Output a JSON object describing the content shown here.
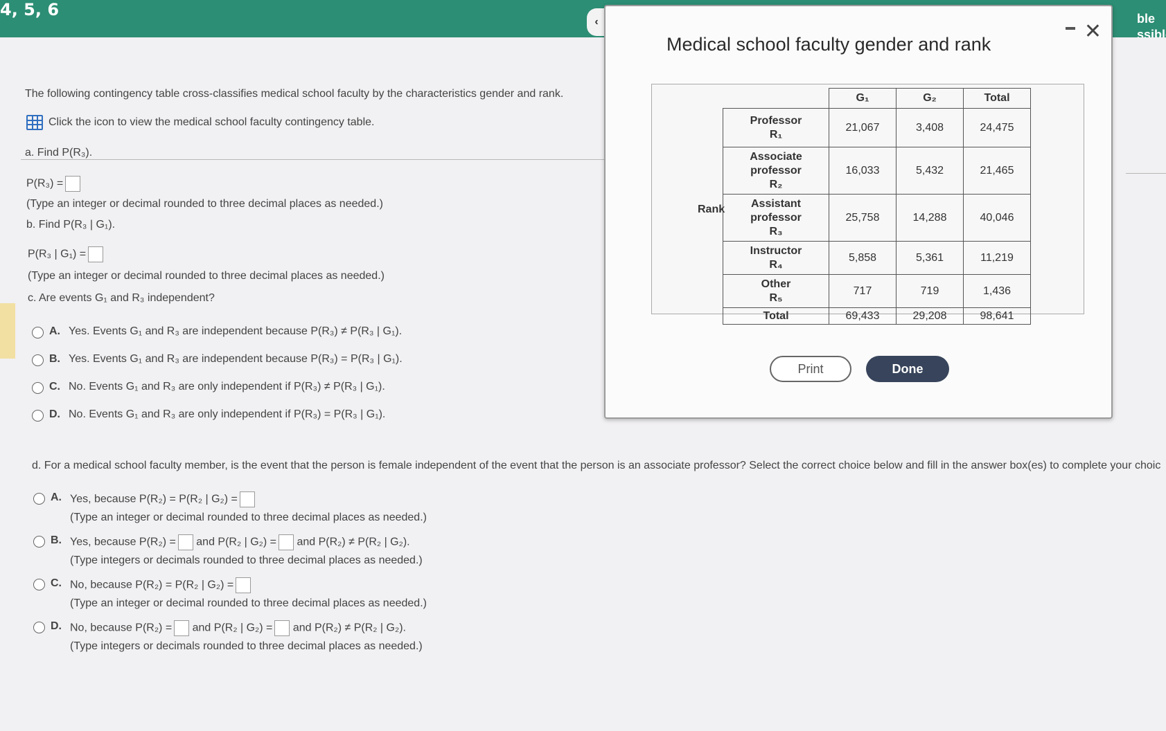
{
  "header": {
    "title": "4, 5, 6",
    "corner_text": "ble ssible"
  },
  "intro": {
    "stem": "The following contingency table cross-classifies medical school faculty by the characteristics gender and rank.",
    "link": "Click the icon to view the medical school faculty contingency table."
  },
  "part_a": {
    "question": "a. Find P(R₃).",
    "answer_label": "P(R₃) =",
    "hint": "(Type an integer or decimal rounded to three decimal places as needed.)"
  },
  "part_b": {
    "question": "b. Find P(R₃ | G₁).",
    "answer_label": "P(R₃ | G₁) =",
    "hint": "(Type an integer or decimal rounded to three decimal places as needed.)"
  },
  "part_c": {
    "question": "c. Are events G₁ and R₃ independent?",
    "options": [
      {
        "letter": "A.",
        "text": "Yes. Events G₁ and R₃ are independent because P(R₃) ≠ P(R₃ | G₁)."
      },
      {
        "letter": "B.",
        "text": "Yes. Events G₁ and R₃ are independent because P(R₃) = P(R₃ | G₁)."
      },
      {
        "letter": "C.",
        "text": "No. Events G₁ and R₃ are only independent if P(R₃) ≠ P(R₃ | G₁)."
      },
      {
        "letter": "D.",
        "text": "No. Events G₁ and R₃ are only independent if P(R₃) = P(R₃ | G₁)."
      }
    ]
  },
  "part_d": {
    "question": "d. For a medical school faculty member, is the event that the person is female independent of the event that the person is an associate professor? Select the correct choice below and fill in the answer box(es) to complete your choic",
    "options": [
      {
        "letter": "A.",
        "text1": "Yes, because P(R₂) = P(R₂ | G₂) =",
        "text2": "",
        "text3": "",
        "hint": "(Type an integer or decimal rounded to three decimal places as needed.)"
      },
      {
        "letter": "B.",
        "text1": "Yes, because P(R₂) =",
        "text2": "and P(R₂ | G₂) =",
        "text3": "and P(R₂) ≠ P(R₂ | G₂).",
        "hint": "(Type integers or decimals rounded to three decimal places as needed.)"
      },
      {
        "letter": "C.",
        "text1": "No, because P(R₂) = P(R₂ | G₂) =",
        "text2": "",
        "text3": "",
        "hint": "(Type an integer or decimal rounded to three decimal places as needed.)"
      },
      {
        "letter": "D.",
        "text1": "No, because P(R₂) =",
        "text2": "and P(R₂ | G₂) =",
        "text3": "and P(R₂) ≠ P(R₂ | G₂).",
        "hint": "(Type integers or decimals rounded to three decimal places as needed.)"
      }
    ]
  },
  "modal": {
    "title": "Medical school faculty gender and rank",
    "rank_label": "Rank",
    "columns": [
      "G₁",
      "G₂",
      "Total"
    ],
    "rows": [
      {
        "label1": "Professor",
        "label2": "",
        "label3": "R₁",
        "values": [
          "21,067",
          "3,408",
          "24,475"
        ]
      },
      {
        "label1": "Associate",
        "label2": "professor",
        "label3": "R₂",
        "values": [
          "16,033",
          "5,432",
          "21,465"
        ]
      },
      {
        "label1": "Assistant",
        "label2": "professor",
        "label3": "R₃",
        "values": [
          "25,758",
          "14,288",
          "40,046"
        ]
      },
      {
        "label1": "Instructor",
        "label2": "",
        "label3": "R₄",
        "values": [
          "5,858",
          "5,361",
          "11,219"
        ]
      },
      {
        "label1": "Other",
        "label2": "",
        "label3": "R₅",
        "values": [
          "717",
          "719",
          "1,436"
        ]
      }
    ],
    "total_row": {
      "label": "Total",
      "values": [
        "69,433",
        "29,208",
        "98,641"
      ]
    },
    "print_label": "Print",
    "done_label": "Done",
    "close_glyph": "✕",
    "collapse_glyph": "‹"
  }
}
